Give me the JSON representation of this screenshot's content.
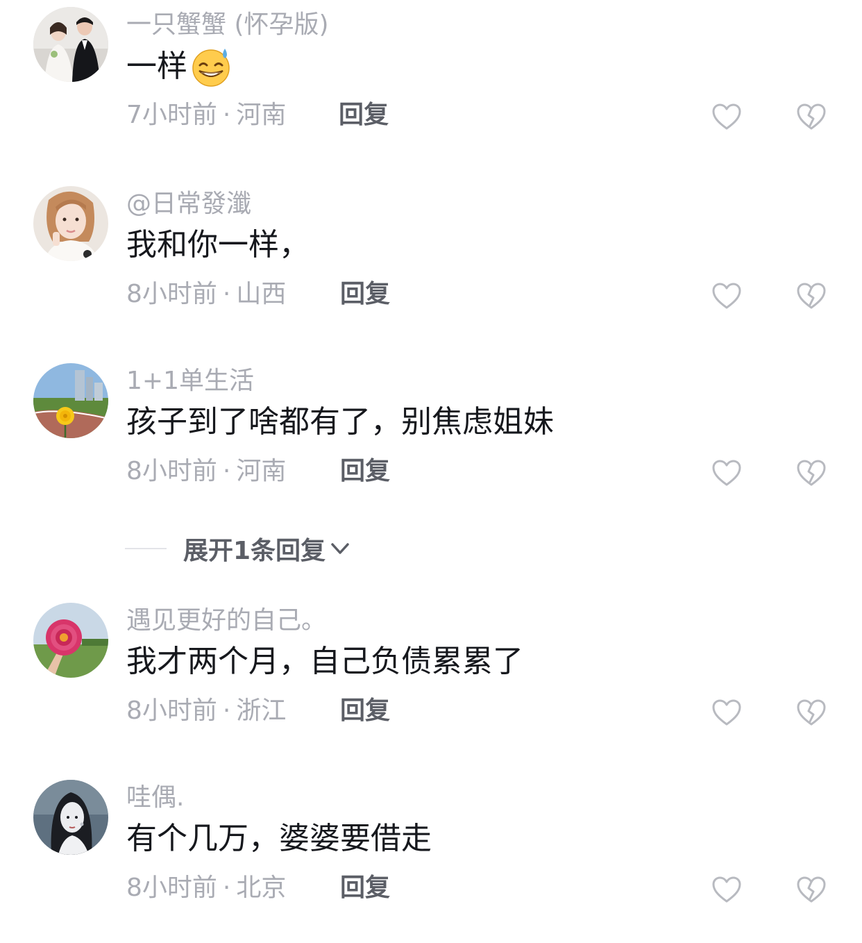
{
  "comments": [
    {
      "username": "一只蟹蟹 (怀孕版)",
      "content": "一样",
      "emoji": "grinning-sweat-emoji",
      "time": "7小时前",
      "location": "河南",
      "reply_label": "回复",
      "avatar": "couple-wedding-photo"
    },
    {
      "username": "@日常發瀸",
      "content": "我和你一样，",
      "time": "8小时前",
      "location": "山西",
      "reply_label": "回复",
      "avatar": "girl-portrait-photo"
    },
    {
      "username": "1+1单生活",
      "content": "孩子到了啥都有了，别焦虑姐妹",
      "time": "8小时前",
      "location": "河南",
      "reply_label": "回复",
      "avatar": "dandelion-road-photo"
    },
    {
      "username": "遇见更好的自己。",
      "content": "我才两个月，自己负债累累了",
      "time": "8小时前",
      "location": "浙江",
      "reply_label": "回复",
      "avatar": "pink-flower-photo"
    },
    {
      "username": "哇偶.",
      "content": "有个几万，婆婆要借走",
      "time": "8小时前",
      "location": "北京",
      "reply_label": "回复",
      "avatar": "anime-girl-portrait"
    }
  ],
  "separator": "·",
  "expand_replies": {
    "label": "展开1条回复",
    "icon": "chevron-down-icon"
  },
  "icons": {
    "like": "heart-outline-icon",
    "dislike": "broken-heart-icon"
  },
  "colors": {
    "username": "#a9abb3",
    "content": "#16181d",
    "reply": "#5b5e66",
    "icon": "#b8bac0"
  }
}
